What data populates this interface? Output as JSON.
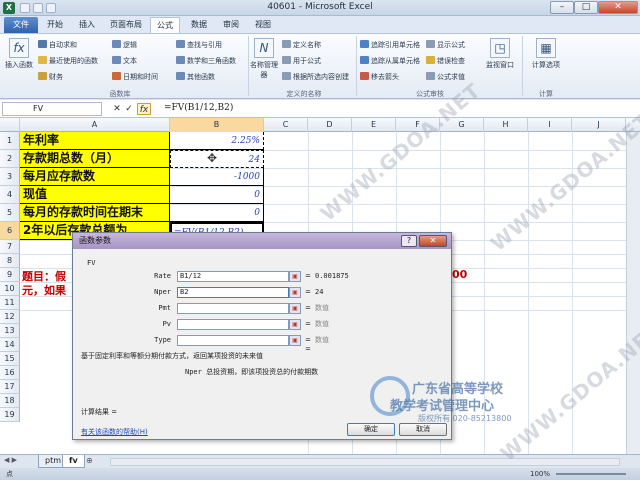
{
  "window": {
    "title": "40601 - Microsoft Excel",
    "app_icon": "X",
    "controls": {
      "minimize": "–",
      "maximize": "□",
      "close": "✕"
    }
  },
  "ribbon_tabs": [
    {
      "label": "文件"
    },
    {
      "label": "开始"
    },
    {
      "label": "插入"
    },
    {
      "label": "页面布局"
    },
    {
      "label": "公式"
    },
    {
      "label": "数据"
    },
    {
      "label": "审阅"
    },
    {
      "label": "视图"
    }
  ],
  "ribbon": {
    "insert_function": "插入函数",
    "group_function_library": "函数库",
    "autosum": "自动求和",
    "recent": "最近使用的函数",
    "financial": "财务",
    "logical": "逻辑",
    "text": "文本",
    "datetime": "日期和时间",
    "lookup": "查找与引用",
    "math": "数学和三角函数",
    "more": "其他函数",
    "name_manager": "名称管理器",
    "define_name": "定义名称",
    "use_in_formula": "用于公式",
    "create_from_sel": "根据所选内容创建",
    "group_defined_names": "定义的名称",
    "trace_precedents": "追踪引用单元格",
    "trace_dependents": "追踪从属单元格",
    "remove_arrows": "移去箭头",
    "show_formulas": "显示公式",
    "error_checking": "错误检查",
    "evaluate": "公式求值",
    "group_auditing": "公式审核",
    "watch_window": "监视窗口",
    "calc_options": "计算选项",
    "group_calculation": "计算"
  },
  "formula_bar": {
    "name_box": "FV",
    "cancel": "✕",
    "enter": "✓",
    "fx": "fx",
    "formula": "=FV(B1/12,B2)"
  },
  "columns": [
    "A",
    "B",
    "C",
    "D",
    "E",
    "F",
    "G",
    "H",
    "I",
    "J"
  ],
  "rows": [
    "1",
    "2",
    "3",
    "4",
    "5",
    "6",
    "7",
    "8",
    "9",
    "10",
    "11",
    "12",
    "13",
    "14",
    "15",
    "16",
    "17",
    "18",
    "19"
  ],
  "cells": [
    {
      "row": "1",
      "a": "年利率",
      "b": "2.25%"
    },
    {
      "row": "2",
      "a": "存款期总数（月）",
      "b": "24"
    },
    {
      "row": "3",
      "a": "每月应存款数",
      "b": "-1000"
    },
    {
      "row": "4",
      "a": "现值",
      "b": "0"
    },
    {
      "row": "5",
      "a": "每月的存款时间在期末",
      "b": "0"
    },
    {
      "row": "6",
      "a": "2年以后存款总额为",
      "b": "=FV(B1/12,B2)"
    }
  ],
  "problem_text": {
    "row10": "题目：假",
    "row11": "元，如果",
    "row10_tail": "00"
  },
  "dialog": {
    "title": "函数参数",
    "help": "?",
    "close": "✕",
    "function_name": "FV",
    "args": [
      {
        "label": "Rate",
        "value": "B1/12",
        "result": "0.001875",
        "dim": false
      },
      {
        "label": "Nper",
        "value": "B2",
        "result": "24",
        "dim": false
      },
      {
        "label": "Pmt",
        "value": "",
        "result": "数值",
        "dim": true
      },
      {
        "label": "Pv",
        "value": "",
        "result": "数值",
        "dim": true
      },
      {
        "label": "Type",
        "value": "",
        "result": "数值",
        "dim": true
      }
    ],
    "result_equals": "=",
    "description": "基于固定利率和等额分期付款方式，返回某项投资的未来值",
    "arg_description": "Nper 总投资期，即该项投资总的付款期数",
    "calc_result": "计算结果 =",
    "help_link": "有关该函数的帮助(H)",
    "ok": "确定",
    "cancel": "取消"
  },
  "sheets": [
    "ptm",
    "fv"
  ],
  "status": {
    "mode": "点",
    "zoom": "100%"
  },
  "watermark": {
    "site": "WWW.GDOA.NET",
    "org1": "广东省高等学校",
    "org2": "教学考试管理中心",
    "org3": "版权所有 020-85213800"
  },
  "colors": {
    "highlight": "#ffff00",
    "accent_blue": "#2a45b5",
    "problem_red": "#c00000"
  }
}
